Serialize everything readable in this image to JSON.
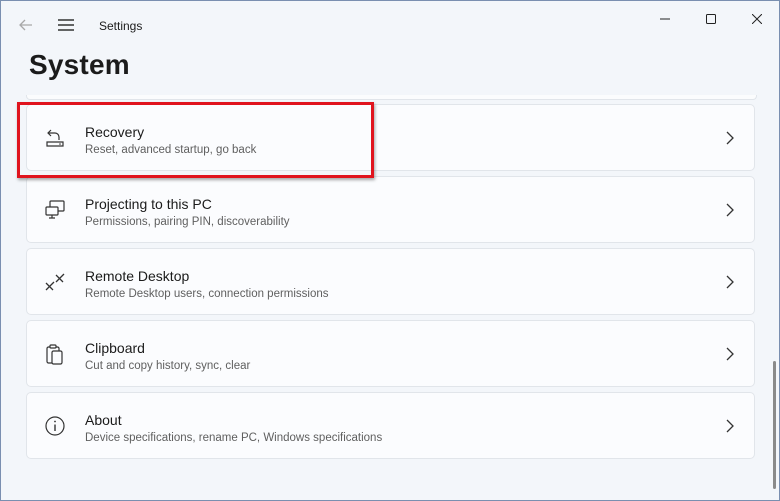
{
  "app": {
    "title": "Settings"
  },
  "page": {
    "title": "System"
  },
  "items": [
    {
      "label": "Recovery",
      "description": "Reset, advanced startup, go back",
      "icon": "recovery-icon"
    },
    {
      "label": "Projecting to this PC",
      "description": "Permissions, pairing PIN, discoverability",
      "icon": "projecting-icon"
    },
    {
      "label": "Remote Desktop",
      "description": "Remote Desktop users, connection permissions",
      "icon": "remote-desktop-icon"
    },
    {
      "label": "Clipboard",
      "description": "Cut and copy history, sync, clear",
      "icon": "clipboard-icon"
    },
    {
      "label": "About",
      "description": "Device specifications, rename PC, Windows specifications",
      "icon": "info-icon"
    }
  ],
  "colors": {
    "highlight": "#e0141e",
    "card": "#fbfcfe",
    "background": "#f3f6fa"
  }
}
